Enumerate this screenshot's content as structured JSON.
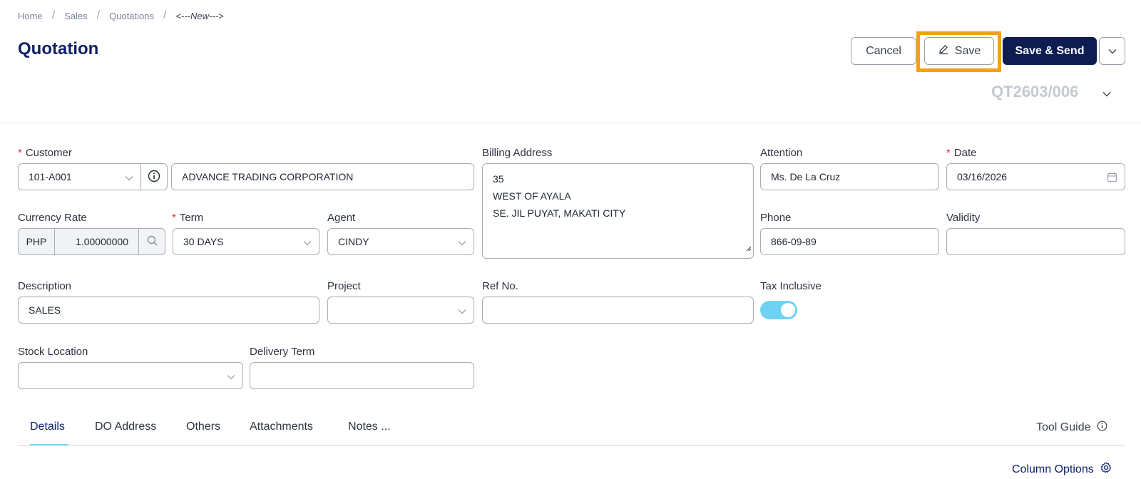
{
  "breadcrumb": [
    "Home",
    "Sales",
    "Quotations",
    "<---New--->"
  ],
  "page_title": "Quotation",
  "actions": {
    "cancel": "Cancel",
    "save": "Save",
    "save_send": "Save & Send"
  },
  "doc_number": "QT2603/006",
  "form": {
    "customer": {
      "label": "Customer",
      "code": "101-A001",
      "name": "ADVANCE TRADING CORPORATION"
    },
    "billing_address": {
      "label": "Billing Address",
      "lines": [
        "35",
        "WEST OF AYALA",
        "SE. JIL PUYAT, MAKATI CITY"
      ]
    },
    "attention": {
      "label": "Attention",
      "value": "Ms. De La Cruz"
    },
    "date": {
      "label": "Date",
      "value": "03/16/2026"
    },
    "currency_rate": {
      "label": "Currency Rate",
      "currency": "PHP",
      "rate": "1.00000000"
    },
    "term": {
      "label": "Term",
      "value": "30 DAYS"
    },
    "agent": {
      "label": "Agent",
      "value": "CINDY"
    },
    "phone": {
      "label": "Phone",
      "value": "866-09-89"
    },
    "validity": {
      "label": "Validity",
      "value": ""
    },
    "description": {
      "label": "Description",
      "value": "SALES"
    },
    "project": {
      "label": "Project",
      "value": ""
    },
    "ref_no": {
      "label": "Ref No.",
      "value": ""
    },
    "tax_inclusive": {
      "label": "Tax Inclusive",
      "on": true
    },
    "stock_location": {
      "label": "Stock Location",
      "value": ""
    },
    "delivery_term": {
      "label": "Delivery Term",
      "value": ""
    }
  },
  "tabs": [
    "Details",
    "DO Address",
    "Others",
    "Attachments",
    "Notes ..."
  ],
  "tool_guide": "Tool Guide",
  "column_options": "Column Options",
  "colors": {
    "primary": "#0d1d52",
    "title": "#0d2167",
    "highlight": "#f5a014",
    "toggle": "#6fd2f2",
    "required": "#e5312b"
  }
}
